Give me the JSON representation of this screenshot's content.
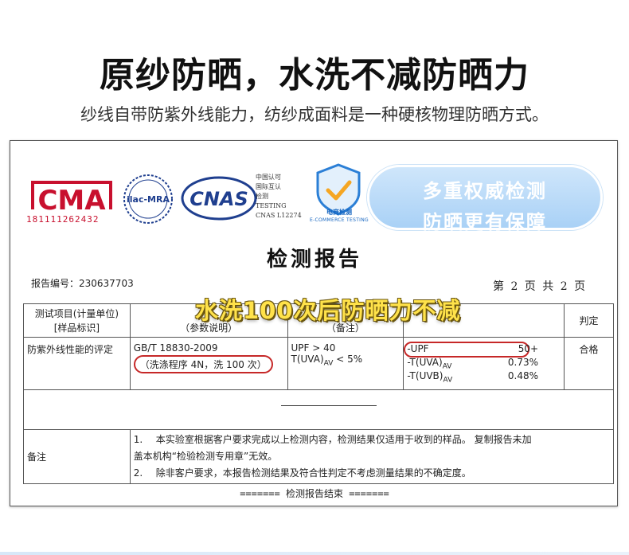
{
  "headline": "原纱防晒，水洗不减防晒力",
  "subline": "纱线自带防紫外线能力，纺纱成面料是一种硬核物理防晒方式。",
  "logos": {
    "cma_text": "CMA",
    "cma_number": "181111262432",
    "ilac_text": "ilac-MRA",
    "cnas_text": "CNAS",
    "cnas_caption": [
      "中国认可",
      "国际互认",
      "检测",
      "TESTING",
      "CNAS L12274"
    ],
    "ecom_label": "电商检测",
    "ecom_sub": "E-COMMERCE TESTING"
  },
  "promo_pill": [
    "多重权威检测",
    "防晒更有保障"
  ],
  "report": {
    "title": "检测报告",
    "number": "报告编号：230637703",
    "page_info": "第 2 页 共 2 页",
    "overlay_caption": "水洗100次后防晒力不减",
    "headers": {
      "col1": [
        "测试项目(计量单位)",
        "[样品标识]"
      ],
      "col2": [
        "（参数说明）"
      ],
      "col3": [
        "（备注）"
      ],
      "col4": [],
      "col5": [
        "判定"
      ]
    },
    "row": {
      "item": "防紫外线性能的评定",
      "standard": "GB/T 18830-2009",
      "wash_note": "（洗涤程序 4N，洗 100 次）",
      "requirement_upf": "UPF > 40",
      "requirement_uva": "T(UVA)",
      "requirement_uva_sub": "AV",
      "requirement_uva_tail": " < 5%",
      "results": [
        {
          "label": "-UPF",
          "sub": "",
          "value": "50+"
        },
        {
          "label": "-T(UVA)",
          "sub": "AV",
          "value": "0.73%"
        },
        {
          "label": "-T(UVB)",
          "sub": "AV",
          "value": "0.48%"
        }
      ],
      "verdict": "合格"
    },
    "note_label": "备注",
    "notes": [
      {
        "num": "1.",
        "text": "本实验室根据客户要求完成以上检测内容，检测结果仅适用于收到的样品。 复制报告未加"
      },
      {
        "num": "",
        "text": "盖本机构“检验检测专用章”无效。"
      },
      {
        "num": "2.",
        "text": "除非客户要求，本报告检测结果及符合性判定不考虑测量结果的不确定度。"
      }
    ],
    "end_line": "======= 检测报告结束 ======="
  },
  "colors": {
    "cma_red": "#c8102e",
    "oval_red": "#c62828",
    "overlay_yellow": "#ffe24a",
    "pill_blue": "#a9d1f6",
    "cnas_blue": "#1f3f8f"
  }
}
